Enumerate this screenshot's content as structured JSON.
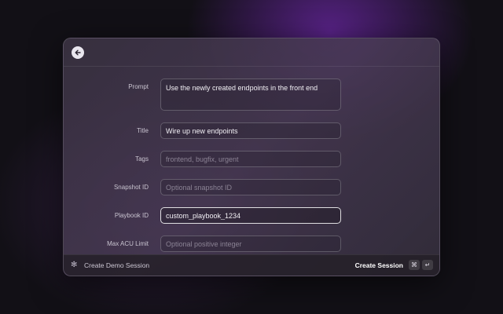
{
  "form": {
    "prompt": {
      "label": "Prompt",
      "value": "Use the newly created endpoints in the front end",
      "placeholder": ""
    },
    "title": {
      "label": "Title",
      "value": "Wire up new endpoints",
      "placeholder": ""
    },
    "tags": {
      "label": "Tags",
      "value": "",
      "placeholder": "frontend, bugfix, urgent"
    },
    "snapshot_id": {
      "label": "Snapshot ID",
      "value": "",
      "placeholder": "Optional snapshot ID"
    },
    "playbook_id": {
      "label": "Playbook ID",
      "value": "custom_playbook_1234",
      "placeholder": ""
    },
    "max_acu_limit": {
      "label": "Max ACU Limit",
      "value": "",
      "placeholder": "Optional positive integer"
    }
  },
  "footer": {
    "demo_icon": "sparkle-icon",
    "demo_label": "Create Demo Session",
    "create_label": "Create Session",
    "shortcut_cmd": "⌘",
    "shortcut_enter": "↵"
  },
  "header": {
    "back_icon": "arrow-left-icon"
  },
  "colors": {
    "background": "#121016",
    "accent_glow": "#6e28aa",
    "text": "#f2f0f5"
  }
}
